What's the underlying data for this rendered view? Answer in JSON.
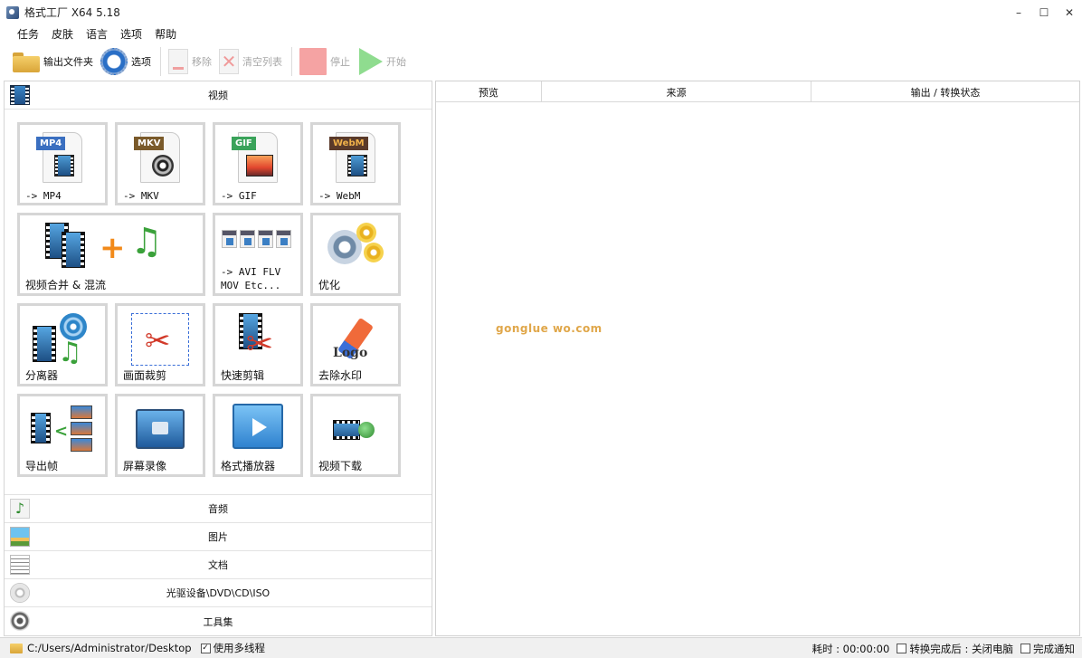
{
  "window": {
    "title": "格式工厂 X64 5.18",
    "minimize": "–",
    "maximize": "☐",
    "close": "✕"
  },
  "menu": [
    "任务",
    "皮肤",
    "语言",
    "选项",
    "帮助"
  ],
  "toolbar": {
    "output_folder": "输出文件夹",
    "options": "选项",
    "remove": "移除",
    "clear_list": "清空列表",
    "stop": "停止",
    "start": "开始"
  },
  "categories": {
    "video": "视频",
    "audio": "音频",
    "image": "图片",
    "document": "文档",
    "rom": "光驱设备\\DVD\\CD\\ISO",
    "tools": "工具集"
  },
  "video_tools": {
    "mp4": {
      "badge": "MP4",
      "label": "-> MP4",
      "color": "#3a6fc0"
    },
    "mkv": {
      "badge": "MKV",
      "label": "-> MKV",
      "color": "#7a5a2a"
    },
    "gif": {
      "badge": "GIF",
      "label": "-> GIF",
      "color": "#3aa35a"
    },
    "webm": {
      "badge": "WebM",
      "label": "-> WebM",
      "color": "#5a3a2a"
    },
    "merge": "视频合并 & 混流",
    "avi": "-> AVI FLV\nMOV Etc...",
    "optimize": "优化",
    "splitter": "分离器",
    "crop": "画面裁剪",
    "quick_cut": "快速剪辑",
    "watermark": "去除水印",
    "export_frames": "导出帧",
    "screen_record": "屏幕录像",
    "player": "格式播放器",
    "downloader": "视频下载",
    "logo_text": "Logo"
  },
  "task_table": {
    "columns": [
      "预览",
      "来源",
      "输出 / 转换状态"
    ],
    "rows": []
  },
  "watermark_text": "gonglue wo.com",
  "status": {
    "path": "C:/Users/Administrator/Desktop",
    "multithread": "使用多线程",
    "elapsed": "耗时 : 00:00:00",
    "shutdown": "转换完成后 : 关闭电脑",
    "notify": "完成通知"
  }
}
